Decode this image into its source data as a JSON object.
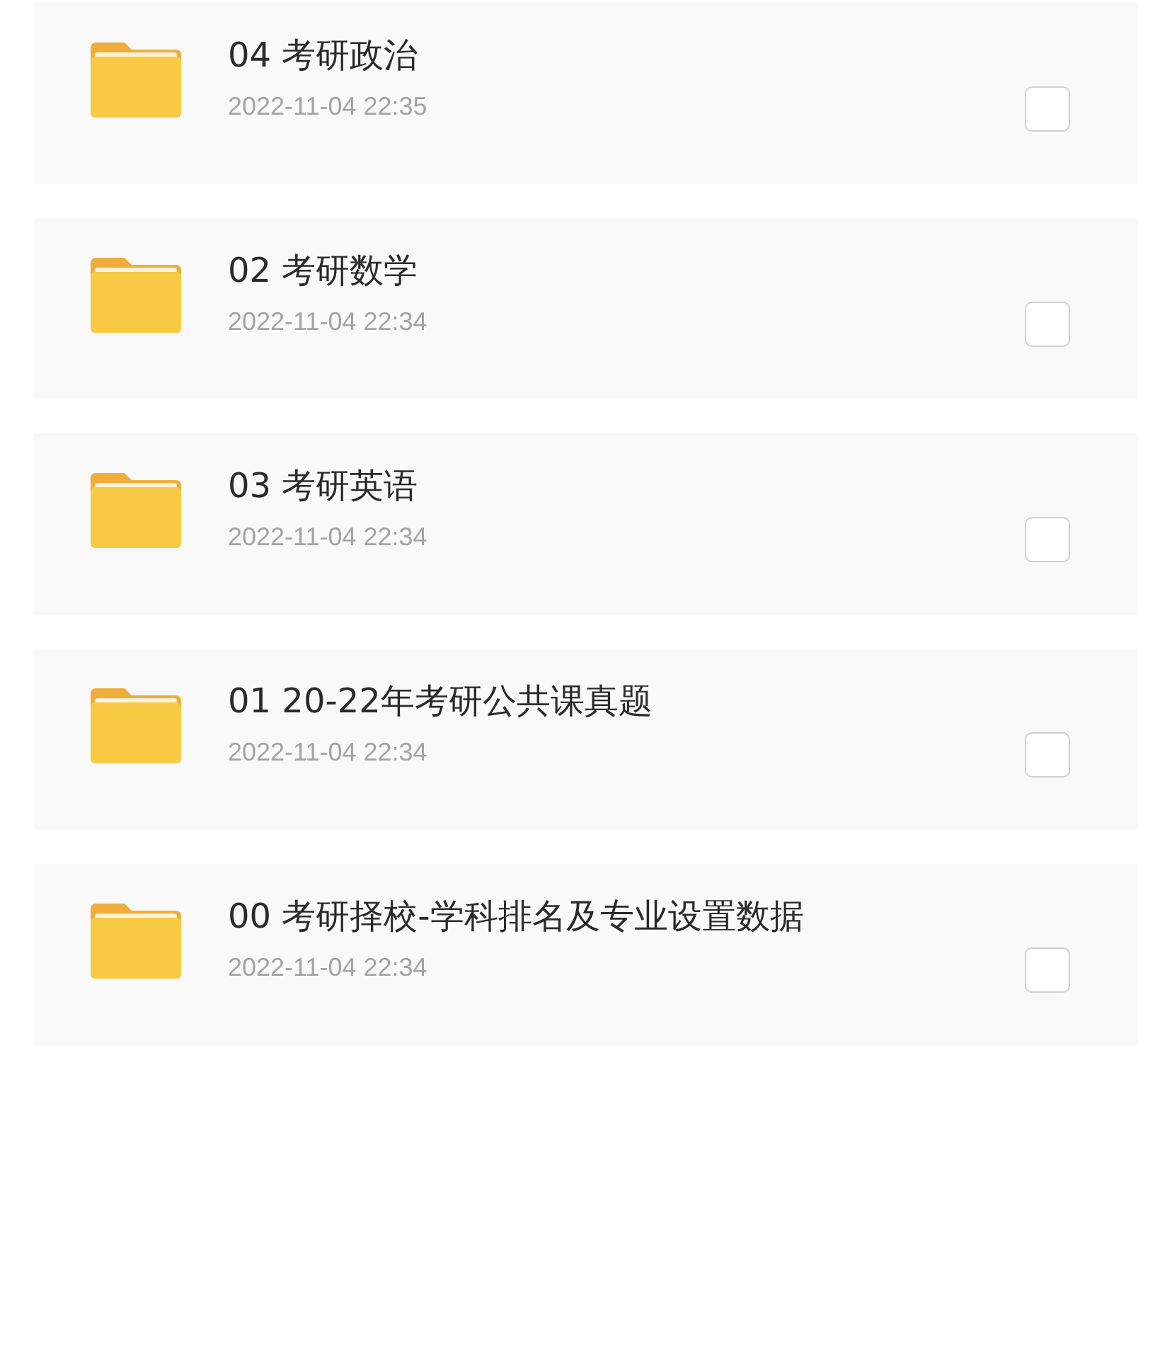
{
  "folders": [
    {
      "name": "04 考研政治",
      "date": "2022-11-04 22:35",
      "checked": false
    },
    {
      "name": "02 考研数学",
      "date": "2022-11-04 22:34",
      "checked": false
    },
    {
      "name": "03 考研英语",
      "date": "2022-11-04 22:34",
      "checked": false
    },
    {
      "name": "01 20-22年考研公共课真题",
      "date": "2022-11-04 22:34",
      "checked": false
    },
    {
      "name": "00 考研择校-学科排名及专业设置数据",
      "date": "2022-11-04 22:34",
      "checked": false
    }
  ]
}
